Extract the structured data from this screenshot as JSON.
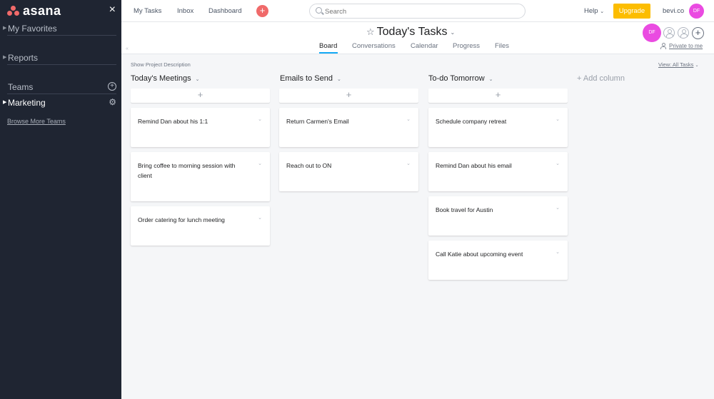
{
  "sidebar": {
    "logo": "asana",
    "close_icon": "×",
    "favorites": "My Favorites",
    "reports": "Reports",
    "teams": "Teams",
    "team": "Marketing",
    "browse": "Browse More Teams"
  },
  "topnav": {
    "my_tasks": "My Tasks",
    "inbox": "Inbox",
    "dashboard": "Dashboard",
    "quick_add": "+",
    "search_placeholder": "Search",
    "help": "Help",
    "help_caret": "⌄",
    "upgrade": "Upgrade",
    "org": "bevi.co",
    "user_initials": "DF"
  },
  "project": {
    "star": "☆",
    "title": "Today's Tasks",
    "title_caret": "⌄",
    "tabs": [
      "Board",
      "Conversations",
      "Calendar",
      "Progress",
      "Files"
    ],
    "member_initials": "DF",
    "add_member": "+",
    "privacy": "Private to me",
    "collapse": "«"
  },
  "board": {
    "show_description": "Show Project Description",
    "view_label": "View: All Tasks",
    "add_column": "+ Add column",
    "add_task_glyph": "+",
    "card_caret": "⌄",
    "columns": [
      {
        "title": "Today's Meetings",
        "cards": [
          "Remind Dan about his 1:1",
          "Bring coffee to morning session with client",
          "Order catering for lunch meeting"
        ]
      },
      {
        "title": "Emails to Send",
        "cards": [
          "Return Carmen's Email",
          "Reach out to ON"
        ]
      },
      {
        "title": "To-do Tomorrow",
        "cards": [
          "Schedule company retreat",
          "Remind Dan about his email",
          "Book travel for Austin",
          "Call Katie about upcoming event"
        ]
      }
    ]
  },
  "colors": {
    "sidebar_bg": "#1f2532",
    "accent_pink": "#ea4be1",
    "upgrade_yellow": "#fcbd01",
    "quick_add_coral": "#f06a6a",
    "tab_underline": "#14aaf5"
  }
}
